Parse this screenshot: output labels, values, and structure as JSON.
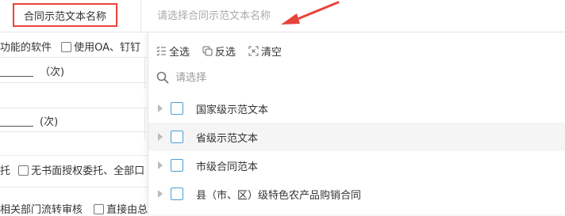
{
  "header": {
    "label": "合同示范文本名称",
    "input_placeholder": "请选择合同示范文本名称",
    "annotation_color": "#e8443a"
  },
  "background_form": {
    "row1_text": "功能的软件",
    "row1_checkbox_label": "使用OA、钉钉",
    "row2_unit": "（次)",
    "row4_unit": "(次)",
    "row6_prefix": "托",
    "row6_checkbox_label": "无书面授权委托、全部口",
    "row7_text": "相关部门流转审核",
    "row7_checkbox_label": "直接由总"
  },
  "dropdown": {
    "toolbar": {
      "select_all": "全选",
      "invert": "反选",
      "clear": "清空"
    },
    "search_placeholder": "请选择",
    "items": [
      {
        "label": "国家级示范文本",
        "icon": "caret-right-icon",
        "checked": false
      },
      {
        "label": "省级示范文本",
        "icon": "caret-right-icon",
        "checked": false,
        "highlighted": true
      },
      {
        "label": "市级合同范本",
        "icon": "caret-right-icon",
        "checked": false
      },
      {
        "label": "县（市、区）级特色农产品购销合同",
        "icon": "caret-right-icon",
        "checked": false
      }
    ],
    "checkbox_color": "#4a9fd6"
  }
}
